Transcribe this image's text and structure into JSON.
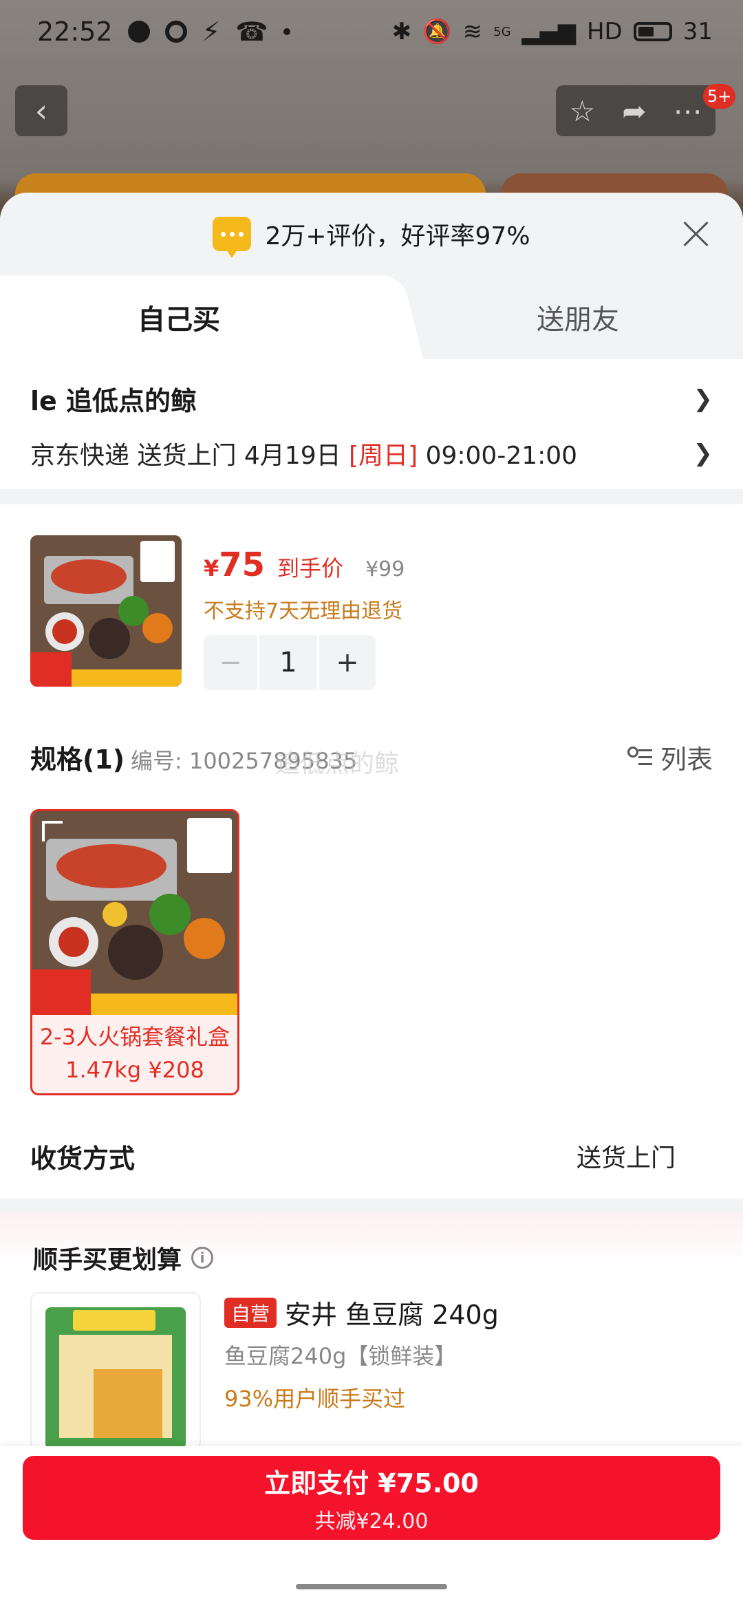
{
  "status_bar": {
    "time": "22:52",
    "network": "5G",
    "hd": "HD",
    "battery": "31"
  },
  "top_nav": {
    "badge": "5+"
  },
  "sheet": {
    "rating_text": "2万+评价，好评率97%",
    "tabs": {
      "buy_self": "自己买",
      "send_friend": "送朋友"
    },
    "address": {
      "name": "le 追低点的鲸",
      "delivery_prefix": "京东快递 送货上门 4月19日 ",
      "delivery_day": "[周日]",
      "delivery_time": " 09:00-21:00"
    },
    "product": {
      "currency": "¥",
      "price": "75",
      "price_label": "到手价",
      "original_price": "¥99",
      "no_return": "不支持7天无理由退货",
      "quantity": "1",
      "minus": "−",
      "plus": "+"
    },
    "spec": {
      "title": "规格(1)",
      "number": "编号: 10025789",
      "number_suffix": "5835",
      "watermark": "追低点的鲸",
      "list_label": "列表",
      "option_label": "2-3人火锅套餐礼盒1.47kg ¥208"
    },
    "shipping": {
      "label": "收货方式",
      "value": "送货上门"
    },
    "addon": {
      "title": "顺手买更划算",
      "tag": "自营",
      "name": "安井 鱼豆腐 240g",
      "spec": "鱼豆腐240g【锁鲜装】",
      "rate": "93%用户顺手买过"
    },
    "pay": {
      "label": "立即支付 ¥75.00",
      "discount": "共减¥24.00"
    }
  },
  "colors": {
    "accent_red": "#e02e24",
    "pay_red": "#f5132b",
    "warn_orange": "#c97a1a"
  }
}
